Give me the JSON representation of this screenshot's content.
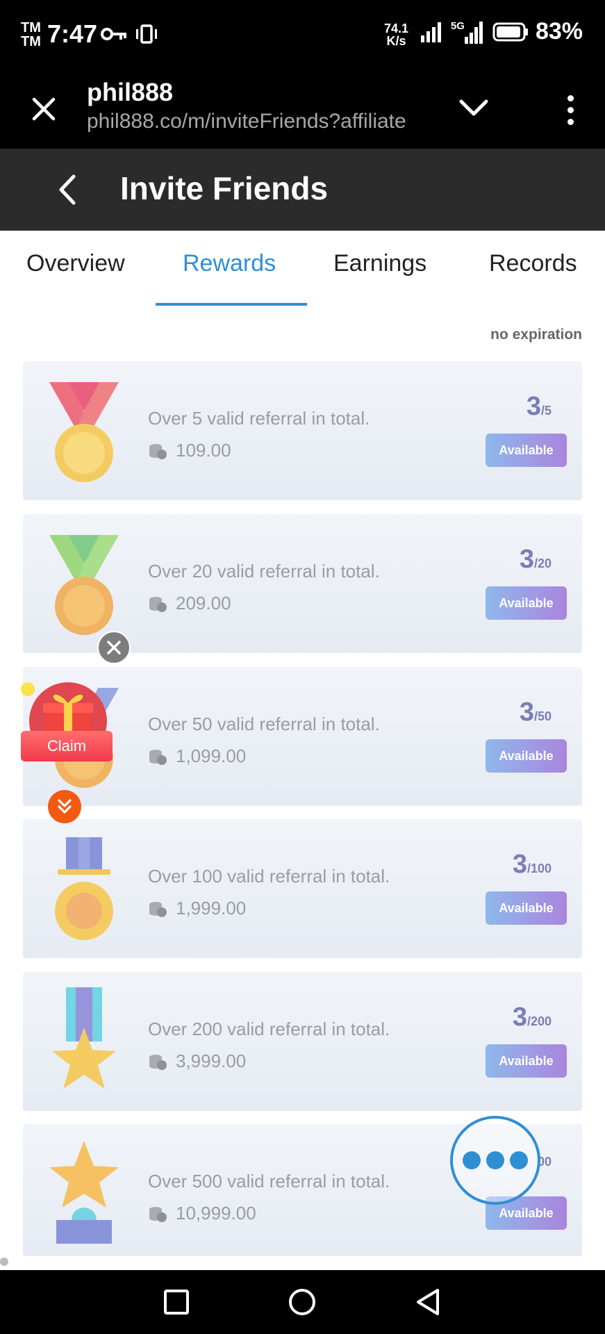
{
  "status_bar": {
    "carrier": "TM",
    "time": "7:47",
    "net_speed_value": "74.1",
    "net_speed_unit": "K/s",
    "network": "5G",
    "battery": "83%"
  },
  "browser": {
    "title": "phil888",
    "url": "phil888.co/m/inviteFriends?affiliate"
  },
  "header": {
    "title": "Invite Friends"
  },
  "tabs": [
    {
      "label": "Overview"
    },
    {
      "label": "Rewards"
    },
    {
      "label": "Earnings"
    },
    {
      "label": "Records"
    }
  ],
  "active_tab": "Rewards",
  "expiry_note": "no expiration",
  "rewards": [
    {
      "medal": "red-medal-icon",
      "description": "Over 5 valid referral in total.",
      "amount": "109.00",
      "current": "3",
      "total": "/5",
      "status": "Available"
    },
    {
      "medal": "green-medal-icon",
      "description": "Over 20 valid referral in total.",
      "amount": "209.00",
      "current": "3",
      "total": "/20",
      "status": "Available"
    },
    {
      "medal": "blue-medal-icon",
      "description": "Over 50 valid referral in total.",
      "amount": "1,099.00",
      "current": "3",
      "total": "/50",
      "status": "Available"
    },
    {
      "medal": "purple-ribbon-medal-icon",
      "description": "Over 100 valid referral in total.",
      "amount": "1,999.00",
      "current": "3",
      "total": "/100",
      "status": "Available"
    },
    {
      "medal": "star-ribbon-medal-icon",
      "description": "Over 200 valid referral in total.",
      "amount": "3,999.00",
      "current": "3",
      "total": "/200",
      "status": "Available"
    },
    {
      "medal": "star-trophy-icon",
      "description": "Over 500 valid referral in total.",
      "amount": "10,999.00",
      "current": "3",
      "total": "00",
      "status": "Available"
    }
  ],
  "floating": {
    "claim_label": "Claim"
  },
  "colors": {
    "accent": "#2f8fd4",
    "header_bg": "#2b2b2b",
    "progress_text": "#7d7cb7",
    "claim_red": "#f03a4c",
    "down_orange": "#f25a12"
  }
}
